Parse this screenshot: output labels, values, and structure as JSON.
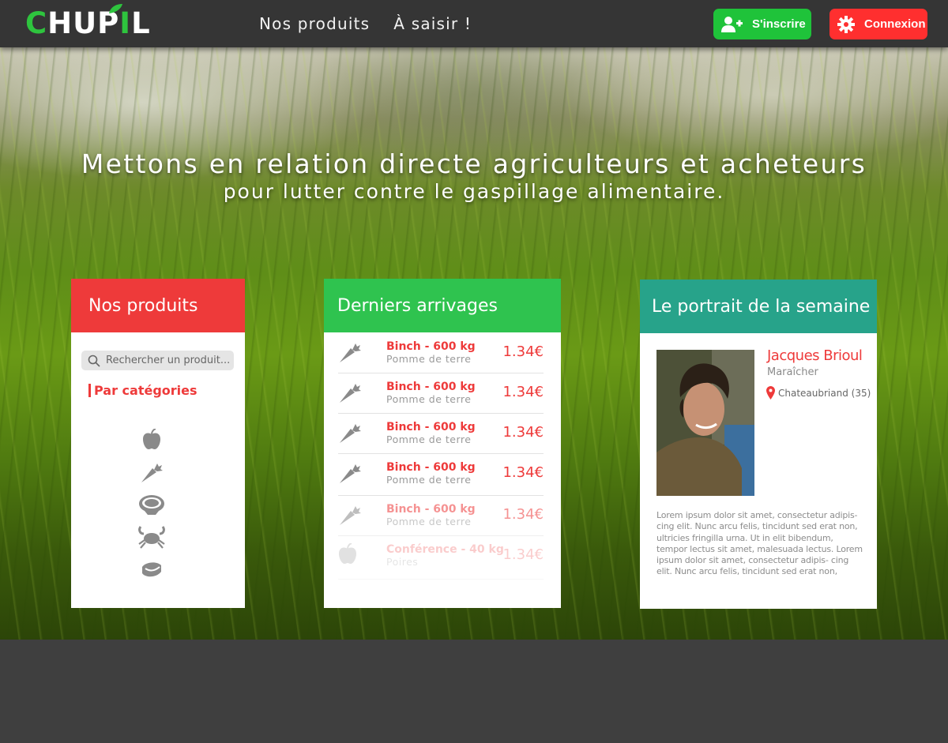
{
  "brand": {
    "logo_text_pre": "CHUP",
    "logo_text_post": "L",
    "logo_letter_i": "I"
  },
  "nav": {
    "items": [
      {
        "label": "Nos produits"
      },
      {
        "label": "À saisir !"
      }
    ]
  },
  "auth": {
    "signup_label": "S'inscrire",
    "login_label": "Connexion"
  },
  "hero": {
    "title": "Mettons en relation directe agriculteurs et acheteurs",
    "subtitle": "pour lutter contre le gaspillage alimentaire."
  },
  "products": {
    "title": "Nos produits",
    "search_placeholder": "Rechercher un produit...",
    "categories_title": "Par catégories",
    "category_icons": [
      "apple-icon",
      "carrot-icon",
      "meat-icon",
      "crab-icon",
      "cheese-icon"
    ]
  },
  "arrivals": {
    "title": "Derniers arrivages",
    "items": [
      {
        "icon": "carrot-icon",
        "title": "Binch - 600 kg",
        "subtitle": "Pomme de terre",
        "price": "1.34€",
        "opacity": 1
      },
      {
        "icon": "carrot-icon",
        "title": "Binch - 600 kg",
        "subtitle": "Pomme de terre",
        "price": "1.34€",
        "opacity": 1
      },
      {
        "icon": "carrot-icon",
        "title": "Binch - 600 kg",
        "subtitle": "Pomme de terre",
        "price": "1.34€",
        "opacity": 1
      },
      {
        "icon": "carrot-icon",
        "title": "Binch - 600 kg",
        "subtitle": "Pomme de terre",
        "price": "1.34€",
        "opacity": 1
      },
      {
        "icon": "carrot-icon",
        "title": "Binch - 600 kg",
        "subtitle": "Pomme de terre",
        "price": "1.34€",
        "opacity": 0.55
      },
      {
        "icon": "apple-icon",
        "title": "Conférence - 40 kg",
        "subtitle": "Poires",
        "price": "1.34€",
        "opacity": 0.25
      }
    ]
  },
  "portrait": {
    "title": "Le portrait de la semaine",
    "name": "Jacques Brioul",
    "role": "Maraîcher",
    "location": "Chateaubriand (35)",
    "bio": "Lorem ipsum dolor sit amet, consectetur adipis- cing elit. Nunc arcu felis, tincidunt sed erat non, ultricies fringilla urna. Ut in elit bibendum, tempor lectus sit amet, malesuada lectus. Lorem ipsum dolor sit amet, consectetur adipis- cing elit. Nunc arcu felis, tincidunt sed erat non,"
  },
  "colors": {
    "red": "#ee3a3a",
    "green": "#2fc34f",
    "teal": "#27a38a",
    "header_bg": "#353535",
    "footer_bg": "#3f3f3f"
  }
}
